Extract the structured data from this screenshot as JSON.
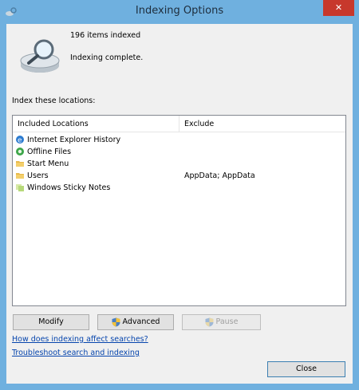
{
  "window": {
    "title": "Indexing Options",
    "close_glyph": "✕"
  },
  "status": {
    "items_indexed": "196 items indexed",
    "message": "Indexing complete."
  },
  "locations": {
    "section_label": "Index these locations:",
    "columns": {
      "included": "Included Locations",
      "exclude": "Exclude"
    },
    "rows": [
      {
        "name": "Internet Explorer History",
        "exclude": "",
        "icon": "ie-icon"
      },
      {
        "name": "Offline Files",
        "exclude": "",
        "icon": "offline-files-icon"
      },
      {
        "name": "Start Menu",
        "exclude": "",
        "icon": "folder-icon"
      },
      {
        "name": "Users",
        "exclude": "AppData; AppData",
        "icon": "folder-icon"
      },
      {
        "name": "Windows Sticky Notes",
        "exclude": "",
        "icon": "sticky-notes-icon"
      }
    ]
  },
  "buttons": {
    "modify": "Modify",
    "advanced": "Advanced",
    "pause": "Pause",
    "close": "Close"
  },
  "links": {
    "affect": "How does indexing affect searches?",
    "troubleshoot": "Troubleshoot search and indexing"
  },
  "colors": {
    "titlebar": "#6fb0df",
    "close": "#c7382c",
    "link": "#0645ad"
  }
}
